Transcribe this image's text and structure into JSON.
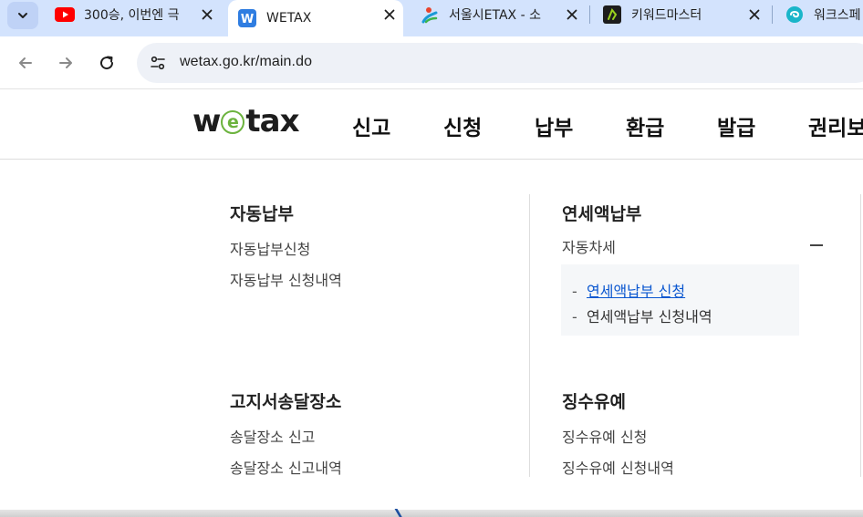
{
  "browser": {
    "tabs": [
      {
        "title": "300승, 이번엔 극",
        "favicon": "youtube-icon",
        "favicon_color": "#ff0000",
        "active": false
      },
      {
        "title": "WETAX",
        "favicon": "wetax-icon",
        "favicon_color": "#2f7de1",
        "active": true
      },
      {
        "title": "서울시ETAX - 소",
        "favicon": "seoul-etax-icon",
        "favicon_color": "#1a9ad6",
        "active": false
      },
      {
        "title": "키워드마스터",
        "favicon": "keyword-master-icon",
        "favicon_color": "#7ab317",
        "active": false
      },
      {
        "title": "워크스페",
        "favicon": "workspace-icon",
        "favicon_color": "#19b5c9",
        "active": false
      }
    ],
    "url": "wetax.go.kr/main.do"
  },
  "site": {
    "logo": {
      "pre": "w",
      "e": "e",
      "post": "tax",
      "accent": "#6cb33e"
    },
    "gnb": [
      "신고",
      "신청",
      "납부",
      "환급",
      "발급",
      "권리보"
    ]
  },
  "menu": {
    "left": [
      {
        "title": "자동납부",
        "links": [
          "자동납부신청",
          "자동납부 신청내역"
        ]
      },
      {
        "title": "고지서송달장소",
        "links": [
          "송달장소 신고",
          "송달장소 신고내역"
        ]
      }
    ],
    "right": [
      {
        "title": "연세액납부",
        "expandable": "자동차세",
        "sub": [
          "연세액납부 신청",
          "연세액납부 신청내역"
        ]
      },
      {
        "title": "징수유예",
        "links": [
          "징수유예 신청",
          "징수유예 신청내역"
        ]
      }
    ]
  },
  "colors": {
    "tabstrip": "#d3e3fd",
    "link": "#0b57d0"
  }
}
